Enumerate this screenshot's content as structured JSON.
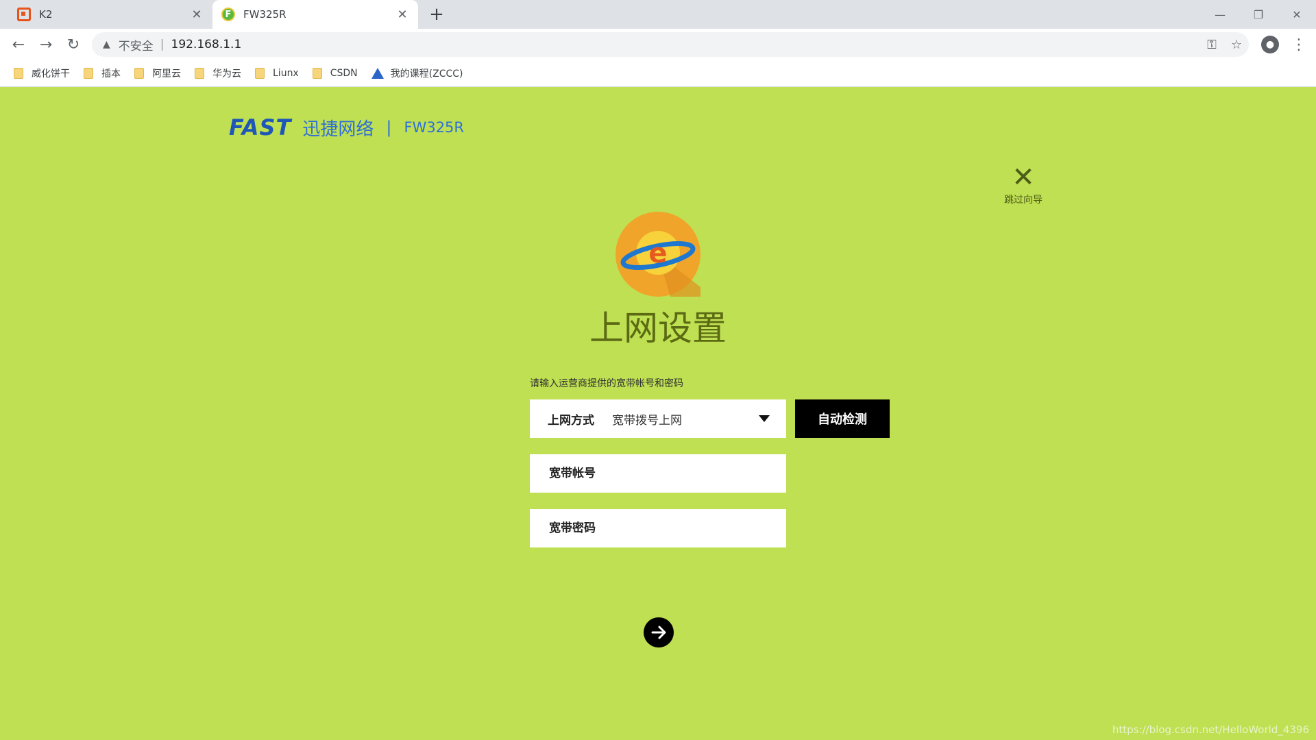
{
  "tabs": [
    {
      "title": "K2",
      "close": "✕"
    },
    {
      "title": "FW325R",
      "close": "✕"
    }
  ],
  "window": {
    "new_tab": "+",
    "minimize": "—",
    "restore": "❐",
    "close": "✕"
  },
  "toolbar": {
    "back": "←",
    "forward": "→",
    "reload": "↻",
    "warning_icon": "▲",
    "security_label": "不安全",
    "separator": "|",
    "url": "192.168.1.1",
    "key_icon": "⚿",
    "star_icon": "☆",
    "menu_icon": "⋮"
  },
  "bookmarks": [
    {
      "label": "威化饼干",
      "icon": "folder"
    },
    {
      "label": "插本",
      "icon": "folder"
    },
    {
      "label": "阿里云",
      "icon": "folder"
    },
    {
      "label": "华为云",
      "icon": "folder"
    },
    {
      "label": "Liunx",
      "icon": "folder"
    },
    {
      "label": "CSDN",
      "icon": "folder"
    },
    {
      "label": "我的课程(ZCCC)",
      "icon": "triangle-logo"
    }
  ],
  "page": {
    "brand": "FAST",
    "brand_cn": "迅捷网络",
    "brand_sep": "|",
    "model": "FW325R",
    "skip_icon": "✕",
    "skip_label": "跳过向导",
    "title": "上网设置",
    "hint": "请输入运营商提供的宽带帐号和密码",
    "mode_label": "上网方式",
    "mode_value": "宽带拨号上网",
    "detect_button": "自动检测",
    "account_placeholder": "宽带帐号",
    "password_placeholder": "宽带密码",
    "globe_letter": "e",
    "watermark": "https://blog.csdn.net/HelloWorld_4396"
  },
  "colors": {
    "page_bg": "#bfe053",
    "brand_blue": "#1e57b7",
    "title": "#5b6a13"
  }
}
